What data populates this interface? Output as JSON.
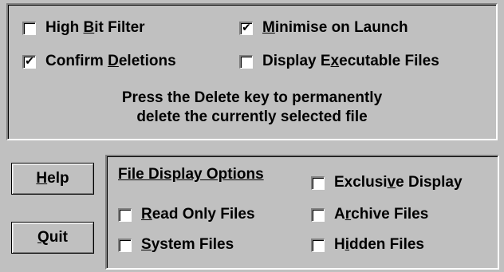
{
  "top_panel": {
    "high_bit_filter": {
      "pre": "High ",
      "acc": "B",
      "post": "it Filter",
      "checked": false
    },
    "minimise_on_launch": {
      "pre": "",
      "acc": "M",
      "post": "inimise on Launch",
      "checked": true
    },
    "confirm_deletions": {
      "pre": "Confirm ",
      "acc": "D",
      "post": "eletions",
      "checked": true
    },
    "display_executable_files": {
      "pre": "Display E",
      "acc": "x",
      "post": "ecutable Files",
      "checked": false
    },
    "message_line1": "Press the Delete key to permanently",
    "message_line2": "delete the currently selected file"
  },
  "buttons": {
    "help": {
      "acc": "H",
      "post": "elp"
    },
    "quit": {
      "acc": "Q",
      "post": "uit"
    }
  },
  "file_display": {
    "title": "File Display Options",
    "exclusive_display": {
      "pre": "Exclusi",
      "acc": "v",
      "post": "e Display",
      "checked": false
    },
    "read_only_files": {
      "pre": "",
      "acc": "R",
      "post": "ead Only Files",
      "checked": false
    },
    "archive_files": {
      "pre": "A",
      "acc": "r",
      "post": "chive Files",
      "checked": false
    },
    "system_files": {
      "pre": "",
      "acc": "S",
      "post": "ystem Files",
      "checked": false
    },
    "hidden_files": {
      "pre": "H",
      "acc": "i",
      "post": "dden Files",
      "checked": false
    }
  },
  "check_glyph": "✔"
}
